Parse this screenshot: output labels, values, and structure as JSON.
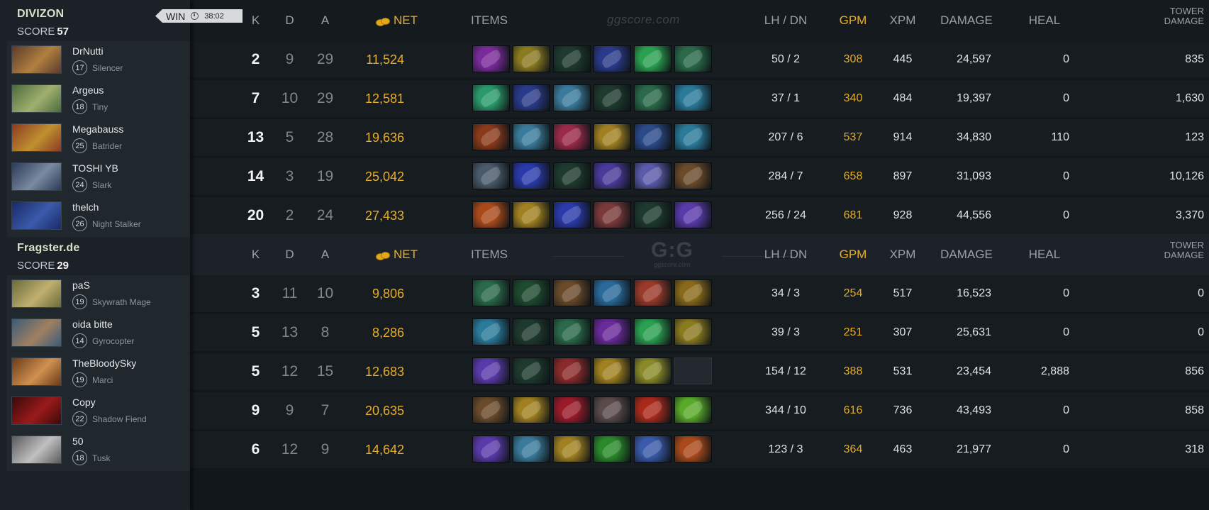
{
  "teams": [
    {
      "name": "DIVIZON",
      "score_label": "SCORE",
      "score": "57",
      "result": "WIN",
      "duration": "38:02",
      "players": [
        {
          "name": "DrNutti",
          "level": "17",
          "hero": "Silencer",
          "k": "2",
          "d": "9",
          "a": "29",
          "net": "11,524",
          "lh_dn": "50  /  2",
          "gpm": "308",
          "xpm": "445",
          "damage": "24,597",
          "heal": "0",
          "tower": "835",
          "portrait_colors": [
            "#5a3a2a",
            "#b08040"
          ],
          "items": [
            "#7a2a9a",
            "#8a7a20",
            "#1e3a2e",
            "#2a3a8a",
            "#2aa050",
            "#2a6a4a"
          ]
        },
        {
          "name": "Argeus",
          "level": "18",
          "hero": "Tiny",
          "k": "7",
          "d": "10",
          "a": "29",
          "net": "12,581",
          "lh_dn": "37  /  1",
          "gpm": "340",
          "xpm": "484",
          "damage": "19,397",
          "heal": "0",
          "tower": "1,630",
          "portrait_colors": [
            "#4a6a3a",
            "#a0b070"
          ],
          "items": [
            "#2a9a6a",
            "#2a3a8a",
            "#3a7a9a",
            "#1e3a2e",
            "#2a6a4a",
            "#2a7a9a"
          ]
        },
        {
          "name": "Megabauss",
          "level": "25",
          "hero": "Batrider",
          "k": "13",
          "d": "5",
          "a": "28",
          "net": "19,636",
          "lh_dn": "207  /  6",
          "gpm": "537",
          "xpm": "914",
          "damage": "34,830",
          "heal": "110",
          "tower": "123",
          "portrait_colors": [
            "#8a3a20",
            "#c09030"
          ],
          "items": [
            "#8a3a1a",
            "#3a7a9a",
            "#9a2a4a",
            "#a08020",
            "#2a4a8a",
            "#2a7a9a"
          ]
        },
        {
          "name": "TOSHI YB",
          "level": "24",
          "hero": "Slark",
          "k": "14",
          "d": "3",
          "a": "19",
          "net": "25,042",
          "lh_dn": "284  /  7",
          "gpm": "658",
          "xpm": "897",
          "damage": "31,093",
          "heal": "0",
          "tower": "10,126",
          "portrait_colors": [
            "#2a3a5a",
            "#7a8aa0"
          ],
          "items": [
            "#4a5a6a",
            "#2a3aaa",
            "#1e3a2e",
            "#4a3a9a",
            "#5a5aaa",
            "#6a4a2a"
          ]
        },
        {
          "name": "thelch",
          "level": "26",
          "hero": "Night Stalker",
          "k": "20",
          "d": "2",
          "a": "24",
          "net": "27,433",
          "lh_dn": "256  /  24",
          "gpm": "681",
          "xpm": "928",
          "damage": "44,556",
          "heal": "0",
          "tower": "3,370",
          "portrait_colors": [
            "#1a2a6a",
            "#3a5aaa"
          ],
          "items": [
            "#aa4a1a",
            "#a08020",
            "#2a3aaa",
            "#7a3a3a",
            "#1e3a2e",
            "#5a3aaa"
          ]
        }
      ]
    },
    {
      "name": "Fragster.de",
      "score_label": "SCORE",
      "score": "29",
      "players": [
        {
          "name": "paS",
          "level": "19",
          "hero": "Skywrath Mage",
          "k": "3",
          "d": "11",
          "a": "10",
          "net": "9,806",
          "lh_dn": "34  /  3",
          "gpm": "254",
          "xpm": "517",
          "damage": "16,523",
          "heal": "0",
          "tower": "0",
          "portrait_colors": [
            "#6a6a3a",
            "#c0b070"
          ],
          "items": [
            "#2a6a4a",
            "#1e4a2e",
            "#6a4a2a",
            "#2a6a9a",
            "#9a3a2a",
            "#8a6a1a"
          ]
        },
        {
          "name": "oida bitte",
          "level": "14",
          "hero": "Gyrocopter",
          "k": "5",
          "d": "13",
          "a": "8",
          "net": "8,286",
          "lh_dn": "39  /  3",
          "gpm": "251",
          "xpm": "307",
          "damage": "25,631",
          "heal": "0",
          "tower": "0",
          "portrait_colors": [
            "#3a5a7a",
            "#a08060"
          ],
          "items": [
            "#2a7a9a",
            "#1e3a2e",
            "#2a6a4a",
            "#6a2a9a",
            "#2aa050",
            "#8a7a20"
          ]
        },
        {
          "name": "TheBloodySky",
          "level": "19",
          "hero": "Marci",
          "k": "5",
          "d": "12",
          "a": "15",
          "net": "12,683",
          "lh_dn": "154  /  12",
          "gpm": "388",
          "xpm": "531",
          "damage": "23,454",
          "heal": "2,888",
          "tower": "856",
          "portrait_colors": [
            "#6a3a1a",
            "#d09050"
          ],
          "items": [
            "#5a3aaa",
            "#1e3a2e",
            "#8a2a2a",
            "#a08020",
            "#8a8a2a",
            "empty"
          ]
        },
        {
          "name": "Copy",
          "level": "22",
          "hero": "Shadow Fiend",
          "k": "9",
          "d": "9",
          "a": "7",
          "net": "20,635",
          "lh_dn": "344  /  10",
          "gpm": "616",
          "xpm": "736",
          "damage": "43,493",
          "heal": "0",
          "tower": "858",
          "portrait_colors": [
            "#3a0a0a",
            "#9a1a1a"
          ],
          "items": [
            "#6a4a2a",
            "#a08020",
            "#9a1a2a",
            "#5a4a4a",
            "#aa2a1a",
            "#5aaa2a"
          ]
        },
        {
          "name": "50",
          "level": "18",
          "hero": "Tusk",
          "k": "6",
          "d": "12",
          "a": "9",
          "net": "14,642",
          "lh_dn": "123  /  3",
          "gpm": "364",
          "xpm": "463",
          "damage": "21,977",
          "heal": "0",
          "tower": "318",
          "portrait_colors": [
            "#5a5a5a",
            "#c0c0c0"
          ],
          "items": [
            "#5a3aaa",
            "#3a7a9a",
            "#a08020",
            "#2a8a2a",
            "#3a5aaa",
            "#aa4a1a"
          ]
        }
      ]
    }
  ],
  "headers": {
    "k": "K",
    "d": "D",
    "a": "A",
    "net": "NET",
    "items": "ITEMS",
    "lh_dn": "LH  /  DN",
    "gpm": "GPM",
    "xpm": "XPM",
    "damage": "DAMAGE",
    "heal": "HEAL",
    "tower_line1": "TOWER",
    "tower_line2": "DAMAGE"
  },
  "watermark": "ggscore.com",
  "logo": {
    "big": "G:G",
    "small": "ggscore.com"
  },
  "colors": {
    "gold": "#e6ad27",
    "bg": "#12171c",
    "panel": "#1b2127"
  }
}
